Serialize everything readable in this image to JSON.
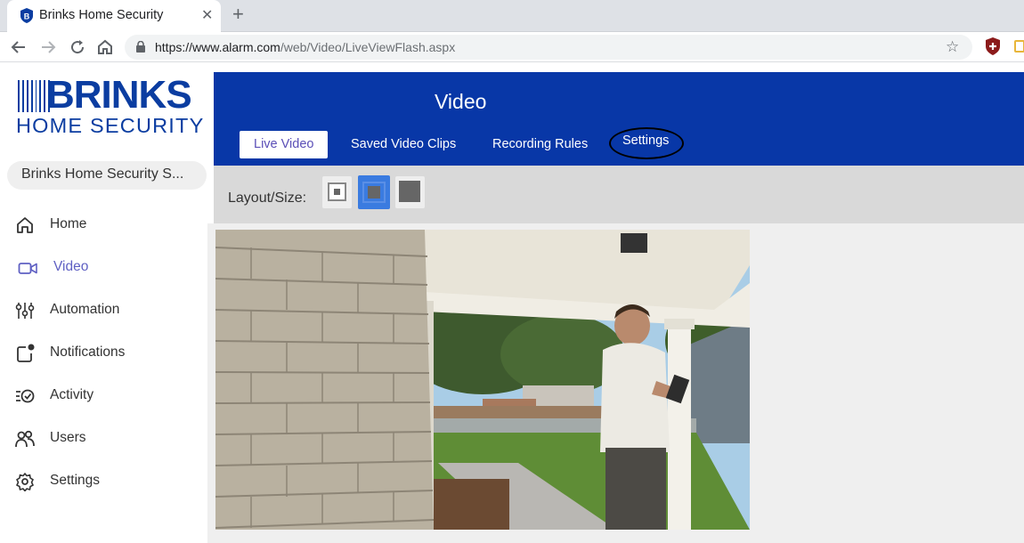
{
  "browser": {
    "tab_title": "Brinks Home Security",
    "tab_close": "✕",
    "new_tab": "+",
    "url_host": "https://www.alarm.com",
    "url_path": "/web/Video/LiveViewFlash.aspx",
    "star": "☆"
  },
  "sidebar": {
    "logo_word": "BRINKS",
    "logo_sub": "HOME SECURITY",
    "site_name": "Brinks Home Security S...",
    "items": [
      {
        "label": "Home",
        "icon": "home-icon"
      },
      {
        "label": "Video",
        "icon": "video-camera-icon",
        "active": true
      },
      {
        "label": "Automation",
        "icon": "sliders-icon"
      },
      {
        "label": "Notifications",
        "icon": "notification-icon"
      },
      {
        "label": "Activity",
        "icon": "activity-icon"
      },
      {
        "label": "Users",
        "icon": "users-icon"
      },
      {
        "label": "Settings",
        "icon": "gear-icon"
      }
    ]
  },
  "header": {
    "title": "Video",
    "tabs": [
      {
        "label": "Live Video",
        "active": true
      },
      {
        "label": "Saved Video Clips"
      },
      {
        "label": "Recording Rules"
      },
      {
        "label": "Settings",
        "circled": true
      }
    ]
  },
  "layout": {
    "label": "Layout/Size:",
    "sizes": [
      "small",
      "medium",
      "large"
    ],
    "selected": "medium"
  },
  "colors": {
    "brand": "#0b3da1",
    "header": "#0837a7",
    "active_nav": "#5f60c3",
    "selected_size": "#3a7be0"
  }
}
